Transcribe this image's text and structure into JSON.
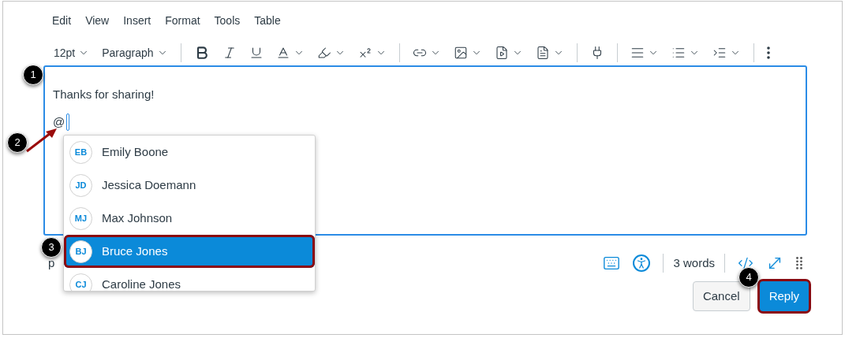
{
  "menu": [
    {
      "label": "Edit"
    },
    {
      "label": "View"
    },
    {
      "label": "Insert"
    },
    {
      "label": "Format"
    },
    {
      "label": "Tools"
    },
    {
      "label": "Table"
    }
  ],
  "toolbar": [
    {
      "kind": "select",
      "label": "12pt"
    },
    {
      "kind": "select",
      "label": "Paragraph"
    },
    {
      "kind": "divider"
    },
    {
      "kind": "bold",
      "menu": false
    },
    {
      "kind": "italic",
      "menu": false
    },
    {
      "kind": "underline",
      "menu": false
    },
    {
      "kind": "text-color",
      "menu": true
    },
    {
      "kind": "highlight",
      "menu": true
    },
    {
      "kind": "superscript",
      "menu": true
    },
    {
      "kind": "divider"
    },
    {
      "kind": "link",
      "menu": true
    },
    {
      "kind": "image",
      "menu": true
    },
    {
      "kind": "media",
      "menu": true
    },
    {
      "kind": "document",
      "menu": true
    },
    {
      "kind": "divider"
    },
    {
      "kind": "plugin",
      "menu": false
    },
    {
      "kind": "divider"
    },
    {
      "kind": "align",
      "menu": true
    },
    {
      "kind": "list",
      "menu": true
    },
    {
      "kind": "indent",
      "menu": true
    },
    {
      "kind": "divider"
    },
    {
      "kind": "more",
      "menu": false
    }
  ],
  "editor": {
    "lines": [
      "Thanks for sharing!",
      "@"
    ]
  },
  "mentions": [
    {
      "initials": "EB",
      "name": "Emily Boone",
      "selected": false
    },
    {
      "initials": "JD",
      "name": "Jessica Doemann",
      "selected": false
    },
    {
      "initials": "MJ",
      "name": "Max Johnson",
      "selected": false
    },
    {
      "initials": "BJ",
      "name": "Bruce Jones",
      "selected": true
    },
    {
      "initials": "CJ",
      "name": "Caroline Jones",
      "selected": false
    }
  ],
  "status_bar": {
    "path": "p",
    "word_count": "3 words"
  },
  "buttons": [
    {
      "label": "Cancel",
      "kind": "secondary",
      "highlighted": false
    },
    {
      "label": "Reply",
      "kind": "primary",
      "highlighted": true
    }
  ],
  "callouts": [
    {
      "label": "1"
    },
    {
      "label": "2"
    },
    {
      "label": "3"
    },
    {
      "label": "4"
    }
  ]
}
